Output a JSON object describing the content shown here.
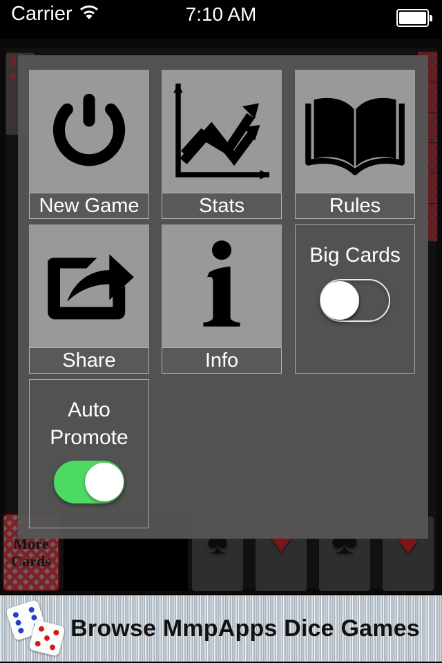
{
  "status_bar": {
    "carrier": "Carrier",
    "wifi_icon": "wifi-icon",
    "time": "7:10 AM",
    "battery_icon": "battery-full-icon"
  },
  "overlay": {
    "menu_items": [
      {
        "id": "new-game",
        "label": "New Game",
        "icon": "power-icon"
      },
      {
        "id": "stats",
        "label": "Stats",
        "icon": "line-chart-icon"
      },
      {
        "id": "rules",
        "label": "Rules",
        "icon": "open-book-icon"
      },
      {
        "id": "share",
        "label": "Share",
        "icon": "share-arrow-icon"
      },
      {
        "id": "info",
        "label": "Info",
        "icon": "info-i-icon"
      }
    ],
    "toggles": [
      {
        "id": "big-cards",
        "label": "Big Cards",
        "state": "off",
        "on_color": "#4CD964"
      },
      {
        "id": "auto-promote",
        "label": "Auto\nPromote",
        "state": "on",
        "on_color": "#4CD964"
      }
    ],
    "toggle_labels": {
      "big_cards": "Big Cards",
      "auto_promote_line1": "Auto",
      "auto_promote_line2": "Promote"
    }
  },
  "board": {
    "stock_label_line1": "More",
    "stock_label_line2": "Cards",
    "visible_card": {
      "rank": "9",
      "suit_symbol": "♥",
      "suit_color": "#7a2027"
    },
    "foundations": [
      {
        "suit": "spade",
        "symbol": "♠",
        "color": "black"
      },
      {
        "suit": "heart",
        "symbol": "♥",
        "color": "red"
      },
      {
        "suit": "club",
        "symbol": "♣",
        "color": "black"
      },
      {
        "suit": "diamond",
        "symbol": "♦",
        "color": "red"
      }
    ]
  },
  "ad_banner": {
    "text": "Browse MmpApps Dice Games",
    "dice_icon": "dice-pair-icon"
  }
}
